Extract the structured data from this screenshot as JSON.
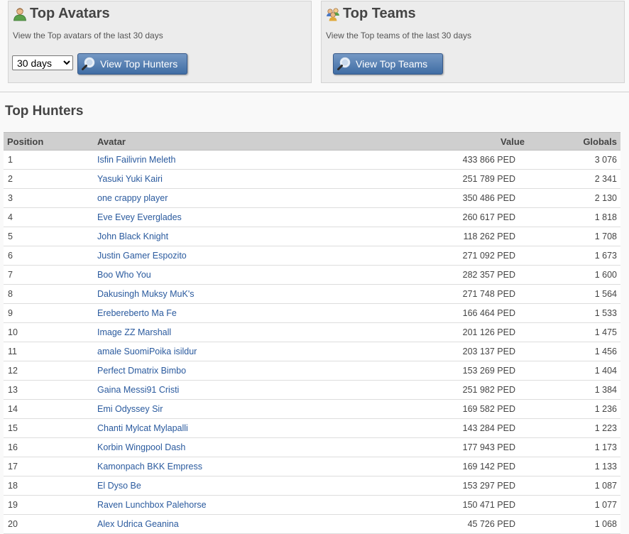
{
  "avatars_panel": {
    "title": "Top Avatars",
    "description": "View the Top avatars of the last 30 days",
    "period_selected": "30 days",
    "button_label": "View Top Hunters"
  },
  "teams_panel": {
    "title": "Top Teams",
    "description": "View the Top teams of the last 30 days",
    "button_label": "View Top Teams"
  },
  "section": {
    "title": "Top Hunters"
  },
  "table": {
    "headers": {
      "position": "Position",
      "avatar": "Avatar",
      "value": "Value",
      "globals": "Globals"
    },
    "rows": [
      {
        "position": "1",
        "avatar": "Isfin Failivrin Meleth",
        "value": "433 866 PED",
        "globals": "3 076"
      },
      {
        "position": "2",
        "avatar": "Yasuki Yuki Kairi",
        "value": "251 789 PED",
        "globals": "2 341"
      },
      {
        "position": "3",
        "avatar": "one crappy player",
        "value": "350 486 PED",
        "globals": "2 130"
      },
      {
        "position": "4",
        "avatar": "Eve Evey Everglades",
        "value": "260 617 PED",
        "globals": "1 818"
      },
      {
        "position": "5",
        "avatar": "John Black Knight",
        "value": "118 262 PED",
        "globals": "1 708"
      },
      {
        "position": "6",
        "avatar": "Justin Gamer Espozito",
        "value": "271 092 PED",
        "globals": "1 673"
      },
      {
        "position": "7",
        "avatar": "Boo Who You",
        "value": "282 357 PED",
        "globals": "1 600"
      },
      {
        "position": "8",
        "avatar": "Dakusingh Muksy MuK's",
        "value": "271 748 PED",
        "globals": "1 564"
      },
      {
        "position": "9",
        "avatar": "Erebereberto Ma Fe",
        "value": "166 464 PED",
        "globals": "1 533"
      },
      {
        "position": "10",
        "avatar": "Image ZZ Marshall",
        "value": "201 126 PED",
        "globals": "1 475"
      },
      {
        "position": "11",
        "avatar": "amale SuomiPoika isildur",
        "value": "203 137 PED",
        "globals": "1 456"
      },
      {
        "position": "12",
        "avatar": "Perfect Dmatrix Bimbo",
        "value": "153 269 PED",
        "globals": "1 404"
      },
      {
        "position": "13",
        "avatar": "Gaina Messi91 Cristi",
        "value": "251 982 PED",
        "globals": "1 384"
      },
      {
        "position": "14",
        "avatar": "Emi Odyssey Sir",
        "value": "169 582 PED",
        "globals": "1 236"
      },
      {
        "position": "15",
        "avatar": "Chanti Mylcat Mylapalli",
        "value": "143 284 PED",
        "globals": "1 223"
      },
      {
        "position": "16",
        "avatar": "Korbin Wingpool Dash",
        "value": "177 943 PED",
        "globals": "1 173"
      },
      {
        "position": "17",
        "avatar": "Kamonpach BKK Empress",
        "value": "169 142 PED",
        "globals": "1 133"
      },
      {
        "position": "18",
        "avatar": "El Dyso Be",
        "value": "153 297 PED",
        "globals": "1 087"
      },
      {
        "position": "19",
        "avatar": "Raven Lunchbox Palehorse",
        "value": "150 471 PED",
        "globals": "1 077"
      },
      {
        "position": "20",
        "avatar": "Alex Udrica Geanina",
        "value": "45 726 PED",
        "globals": "1 068"
      }
    ]
  },
  "icons": {
    "avatar_panel_icon": "user-icon",
    "teams_panel_icon": "users-group-icon",
    "button_icon": "magnifier-icon"
  },
  "colors": {
    "link": "#2a5a9e",
    "button": "#4a77ac",
    "header_bg": "#cfcfcf"
  }
}
